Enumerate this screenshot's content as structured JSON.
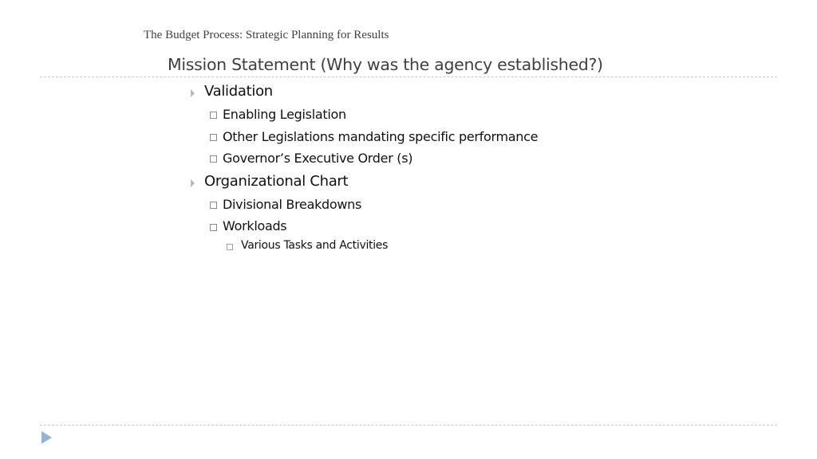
{
  "header": {
    "text": "The Budget Process:  Strategic Planning for Results"
  },
  "title": "Mission Statement (Why was the agency established?)",
  "bullets": [
    {
      "label": "Validation",
      "children": [
        {
          "label": "Enabling Legislation"
        },
        {
          "label": "Other Legislations mandating specific performance"
        },
        {
          "label": "Governor’s Executive Order (s)"
        }
      ]
    },
    {
      "label": "Organizational Chart",
      "children": [
        {
          "label": "Divisional Breakdowns"
        },
        {
          "label": "Workloads",
          "children": [
            {
              "label": "Various Tasks and Activities"
            }
          ]
        }
      ]
    }
  ],
  "icons": {
    "level1": "triangle-bullet-icon",
    "level2": "square-bullet-icon",
    "footer": "play-arrow-icon"
  },
  "colors": {
    "accent": "#95b3d7",
    "text": "#404040"
  }
}
